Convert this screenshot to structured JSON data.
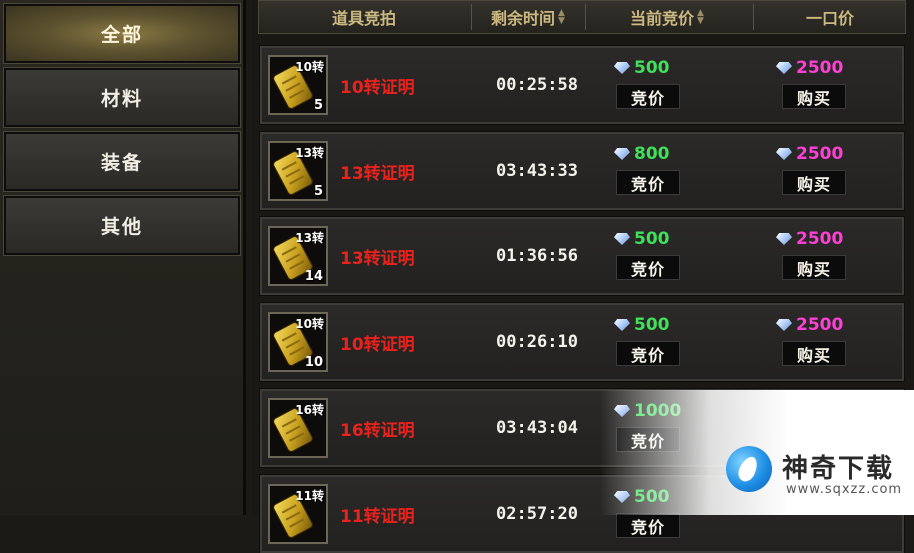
{
  "sidebar": {
    "categories": [
      {
        "label": "全部",
        "active": true
      },
      {
        "label": "材料",
        "active": false
      },
      {
        "label": "装备",
        "active": false
      },
      {
        "label": "其他",
        "active": false
      }
    ]
  },
  "table": {
    "headers": {
      "item": "道具竞拍",
      "time": "剩余时间",
      "current_bid": "当前竞价",
      "buyout": "一口价"
    },
    "bid_button": "竞价",
    "buy_button": "购买",
    "rows": [
      {
        "rank": "10转",
        "qty": "5",
        "name": "10转证明",
        "time": "00:25:58",
        "bid": "500",
        "buyout": "2500"
      },
      {
        "rank": "13转",
        "qty": "5",
        "name": "13转证明",
        "time": "03:43:33",
        "bid": "800",
        "buyout": "2500"
      },
      {
        "rank": "13转",
        "qty": "14",
        "name": "13转证明",
        "time": "01:36:56",
        "bid": "500",
        "buyout": "2500"
      },
      {
        "rank": "10转",
        "qty": "10",
        "name": "10转证明",
        "time": "00:26:10",
        "bid": "500",
        "buyout": "2500"
      },
      {
        "rank": "16转",
        "qty": "",
        "name": "16转证明",
        "time": "03:43:04",
        "bid": "1000",
        "buyout": ""
      },
      {
        "rank": "11转",
        "qty": "",
        "name": "11转证明",
        "time": "02:57:20",
        "bid": "500",
        "buyout": ""
      }
    ]
  },
  "watermark": {
    "title": "神奇下载",
    "url": "www.sqxzz.com"
  },
  "colors": {
    "item_name": "#e8231d",
    "bid_price": "#3fe05a",
    "buyout_price": "#ff3fd7",
    "header_text": "#cbb981"
  },
  "icons": {
    "item": "gold-scroll-icon",
    "currency": "diamond-icon",
    "sort": "sort-arrows-icon"
  }
}
